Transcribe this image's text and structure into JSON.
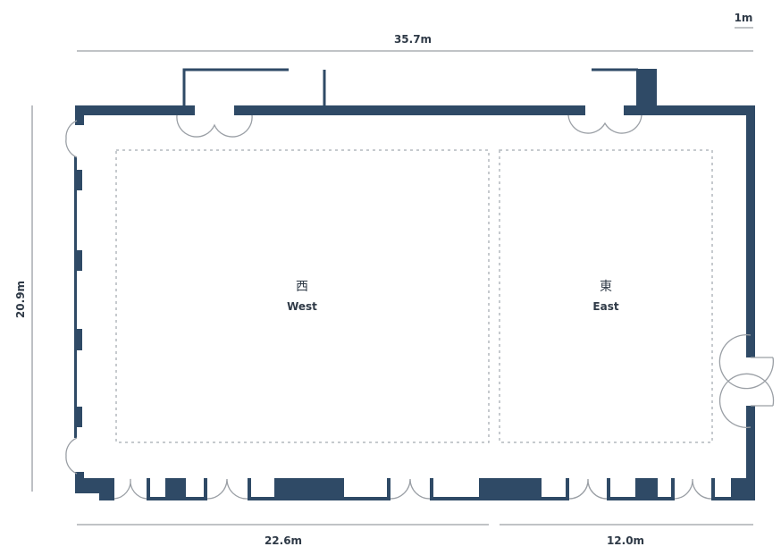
{
  "dimensions": {
    "total_width": "35.7m",
    "total_height": "20.9m",
    "west_width": "22.6m",
    "east_width": "12.0m",
    "scale": "1m"
  },
  "rooms": [
    {
      "name_cjk": "西",
      "name": "West"
    },
    {
      "name_cjk": "東",
      "name": "East"
    }
  ],
  "colors": {
    "wall": "#2f4a66",
    "dimension": "#9a9fa5",
    "room_outline": "#b4b8bd"
  }
}
